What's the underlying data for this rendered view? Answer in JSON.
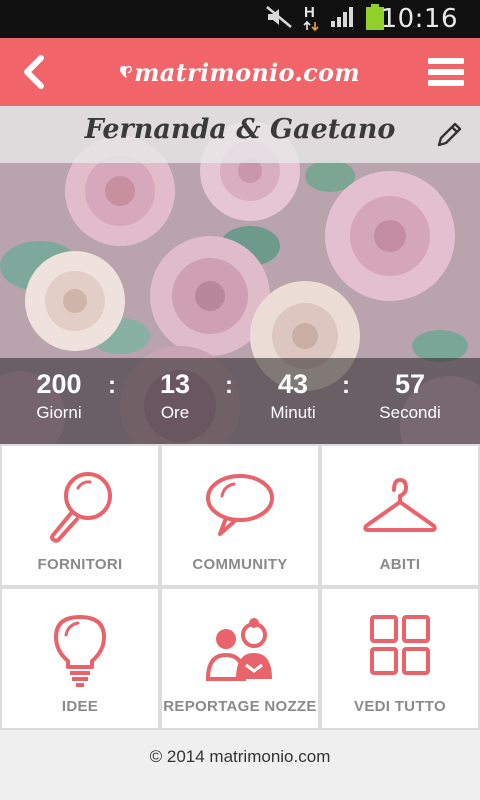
{
  "status_bar": {
    "time": "10:16",
    "network": "H",
    "icons": [
      "mute-icon",
      "network-type-icon",
      "signal-icon",
      "battery-icon"
    ]
  },
  "header": {
    "logo_text": "matrimonio.com",
    "back_icon": "back-icon",
    "menu_icon": "menu-icon"
  },
  "hero": {
    "couple": "Fernanda & Gaetano",
    "edit_icon": "pencil-icon",
    "countdown": [
      {
        "value": "200",
        "label": "Giorni"
      },
      {
        "value": "13",
        "label": "Ore"
      },
      {
        "value": "43",
        "label": "Minuti"
      },
      {
        "value": "57",
        "label": "Secondi"
      }
    ],
    "separator": ":"
  },
  "tiles": [
    {
      "label": "FORNITORI",
      "icon": "magnifier-icon"
    },
    {
      "label": "COMMUNITY",
      "icon": "speech-bubble-icon"
    },
    {
      "label": "ABITI",
      "icon": "hanger-icon"
    },
    {
      "label": "IDEE",
      "icon": "lightbulb-icon"
    },
    {
      "label": "REPORTAGE NOZZE",
      "icon": "couple-icon"
    },
    {
      "label": "VEDI TUTTO",
      "icon": "grid-icon"
    }
  ],
  "footer": {
    "copyright": "© 2014 matrimonio.com"
  },
  "colors": {
    "brand": "#f0646a",
    "icon": "#e8636a",
    "tile_label": "#8a8a8a",
    "status_bar": "#101010",
    "battery": "#8fd12a"
  }
}
